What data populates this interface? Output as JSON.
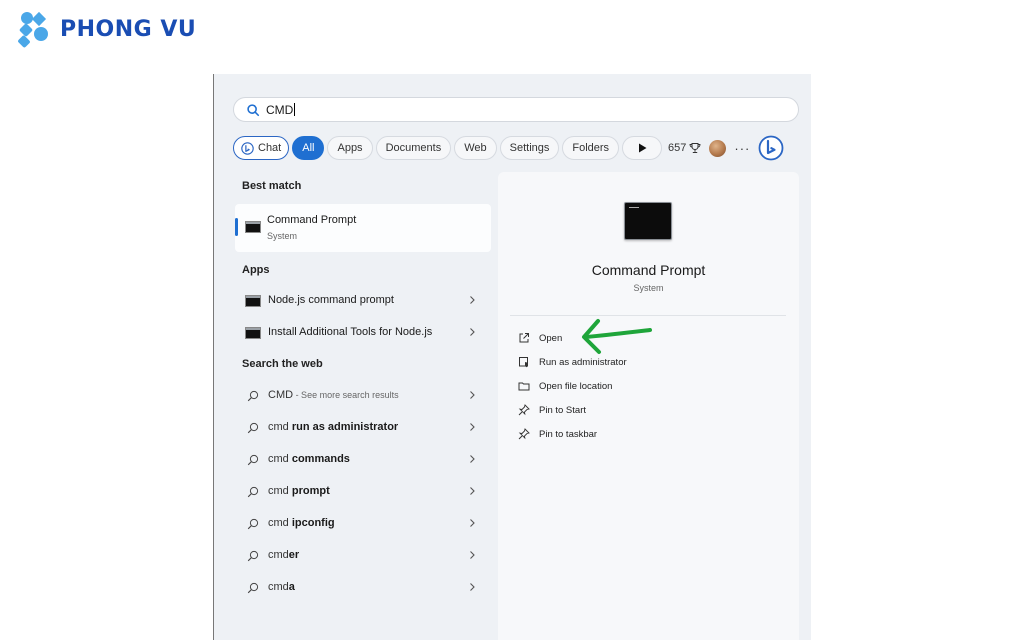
{
  "brand": {
    "name": "PHONG VU",
    "color": "#1a4db3",
    "accent": "#4aa7e8"
  },
  "search": {
    "value": "CMD"
  },
  "filters": [
    {
      "label": "Chat",
      "icon": "bing-icon"
    },
    {
      "label": "All",
      "active": true
    },
    {
      "label": "Apps"
    },
    {
      "label": "Documents"
    },
    {
      "label": "Web"
    },
    {
      "label": "Settings"
    },
    {
      "label": "Folders"
    },
    {
      "label": "",
      "icon": "play-icon"
    }
  ],
  "toolbar": {
    "points": "657",
    "points_icon": "trophy-icon",
    "more": "···"
  },
  "sections": {
    "best_match": "Best match",
    "apps": "Apps",
    "search_web": "Search the web"
  },
  "best_match": {
    "title": "Command Prompt",
    "subtitle": "System"
  },
  "apps": [
    {
      "label": "Node.js command prompt"
    },
    {
      "label": "Install Additional Tools for Node.js"
    }
  ],
  "web_results": [
    {
      "prefix": "CMD",
      "bold": "",
      "hint": " - See more search results"
    },
    {
      "prefix": "cmd ",
      "bold": "run as administrator",
      "hint": ""
    },
    {
      "prefix": "cmd ",
      "bold": "commands",
      "hint": ""
    },
    {
      "prefix": "cmd ",
      "bold": "prompt",
      "hint": ""
    },
    {
      "prefix": "cmd ",
      "bold": "ipconfig",
      "hint": ""
    },
    {
      "prefix": "cmd",
      "bold": "er",
      "hint": ""
    },
    {
      "prefix": "cmd",
      "bold": "a",
      "hint": ""
    }
  ],
  "detail": {
    "title": "Command Prompt",
    "subtitle": "System",
    "actions": [
      {
        "label": "Open",
        "icon": "open-external-icon"
      },
      {
        "label": "Run as administrator",
        "icon": "shield-icon"
      },
      {
        "label": "Open file location",
        "icon": "folder-icon"
      },
      {
        "label": "Pin to Start",
        "icon": "pin-icon"
      },
      {
        "label": "Pin to taskbar",
        "icon": "pin-icon"
      }
    ]
  },
  "annotation": {
    "arrow_color": "#1fa53a"
  }
}
